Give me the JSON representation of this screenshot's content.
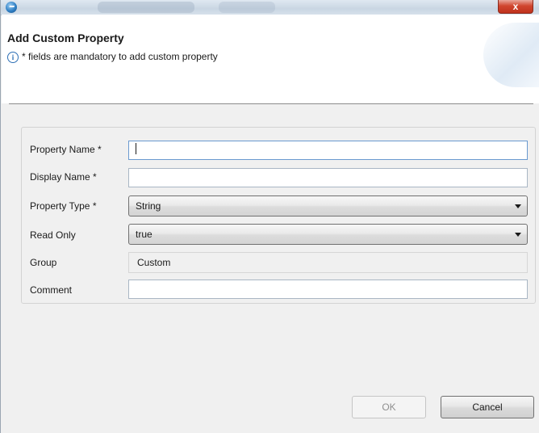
{
  "window": {
    "close_label": "x"
  },
  "header": {
    "title": "Add Custom Property",
    "info_icon": "i",
    "info_text": "* fields are mandatory to add custom property"
  },
  "form": {
    "property_name": {
      "label": "Property Name *",
      "value": ""
    },
    "display_name": {
      "label": "Display Name *",
      "value": ""
    },
    "property_type": {
      "label": "Property Type *",
      "value": "String"
    },
    "read_only": {
      "label": "Read Only",
      "value": "true"
    },
    "group": {
      "label": "Group",
      "value": "Custom"
    },
    "comment": {
      "label": "Comment",
      "value": ""
    }
  },
  "buttons": {
    "ok_label": "OK",
    "ok_enabled": false,
    "cancel_label": "Cancel"
  },
  "icons": {
    "app": "app-logo-icon",
    "close": "close-icon",
    "info": "info-icon",
    "dropdown": "chevron-down-icon"
  }
}
